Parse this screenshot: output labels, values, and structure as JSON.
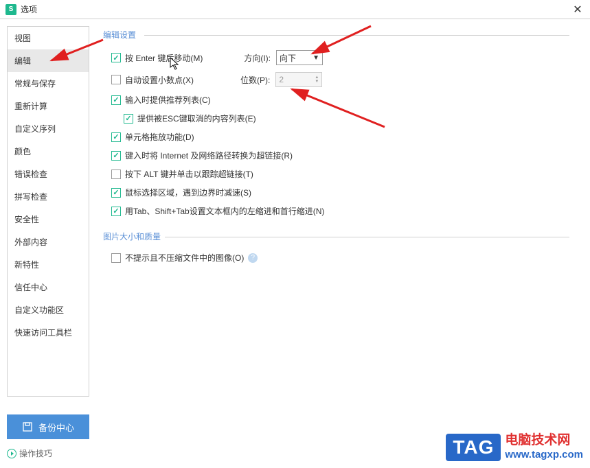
{
  "titlebar": {
    "title": "选项"
  },
  "sidebar": {
    "items": [
      {
        "label": "视图"
      },
      {
        "label": "编辑"
      },
      {
        "label": "常规与保存"
      },
      {
        "label": "重新计算"
      },
      {
        "label": "自定义序列"
      },
      {
        "label": "颜色"
      },
      {
        "label": "错误检查"
      },
      {
        "label": "拼写检查"
      },
      {
        "label": "安全性"
      },
      {
        "label": "外部内容"
      },
      {
        "label": "新特性"
      },
      {
        "label": "信任中心"
      },
      {
        "label": "自定义功能区"
      },
      {
        "label": "快速访问工具栏"
      }
    ],
    "active_index": 1
  },
  "section_edit": {
    "title": "编辑设置",
    "opt_enter_move": {
      "label": "按 Enter 键后移动(M)",
      "checked": true
    },
    "direction_label": "方向(I):",
    "direction_value": "向下",
    "opt_auto_decimal": {
      "label": "自动设置小数点(X)",
      "checked": false
    },
    "digits_label": "位数(P):",
    "digits_value": "2",
    "opt_suggest_list": {
      "label": "输入时提供推荐列表(C)",
      "checked": true
    },
    "opt_esc_list": {
      "label": "提供被ESC键取消的内容列表(E)",
      "checked": true
    },
    "opt_drag_fill": {
      "label": "单元格拖放功能(D)",
      "checked": true
    },
    "opt_hyperlink": {
      "label": "键入时将 Internet 及网络路径转换为超链接(R)",
      "checked": true
    },
    "opt_alt_click": {
      "label": "按下 ALT 键并单击以跟踪超链接(T)",
      "checked": false
    },
    "opt_mouse_select": {
      "label": "鼠标选择区域，遇到边界时减速(S)",
      "checked": true
    },
    "opt_tab_indent": {
      "label": "用Tab、Shift+Tab设置文本框内的左缩进和首行缩进(N)",
      "checked": true
    }
  },
  "section_image": {
    "title": "图片大小和质量",
    "opt_no_compress": {
      "label": "不提示且不压缩文件中的图像(O)",
      "checked": false
    }
  },
  "footer": {
    "backup_label": "备份中心",
    "tips_label": "操作技巧"
  },
  "watermark": {
    "tag": "TAG",
    "cn": "电脑技术网",
    "url": "www.tagxp.com"
  }
}
